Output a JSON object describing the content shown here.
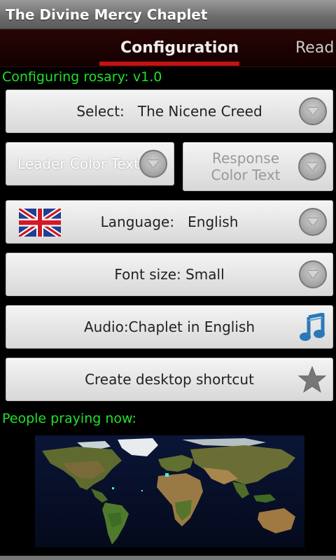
{
  "app": {
    "title": "The Divine Mercy Chaplet"
  },
  "tabs": [
    {
      "label": "Configuration",
      "active": true
    },
    {
      "label": "Read",
      "active": false
    }
  ],
  "config": {
    "heading": "Configuring rosary: v1.0"
  },
  "buttons": {
    "select": {
      "prefix": "Select:",
      "value": "The Nicene Creed"
    },
    "leader_color": "Leader Color Text",
    "response_color": "Response Color Text",
    "language": {
      "prefix": "Language:",
      "value": "English"
    },
    "font_size": "Font size: Small",
    "audio": "Audio:Chaplet in English",
    "shortcut": "Create desktop shortcut"
  },
  "praying": {
    "heading": "People praying now:"
  },
  "icons": {
    "dropdown": "chevron-down-circle-icon",
    "flag": "uk-flag-icon",
    "audio": "music-note-icon",
    "shortcut": "star-icon"
  },
  "colors": {
    "accent_green": "#22e02a",
    "tab_indicator": "#c21313",
    "music_blue": "#2b78b8"
  }
}
